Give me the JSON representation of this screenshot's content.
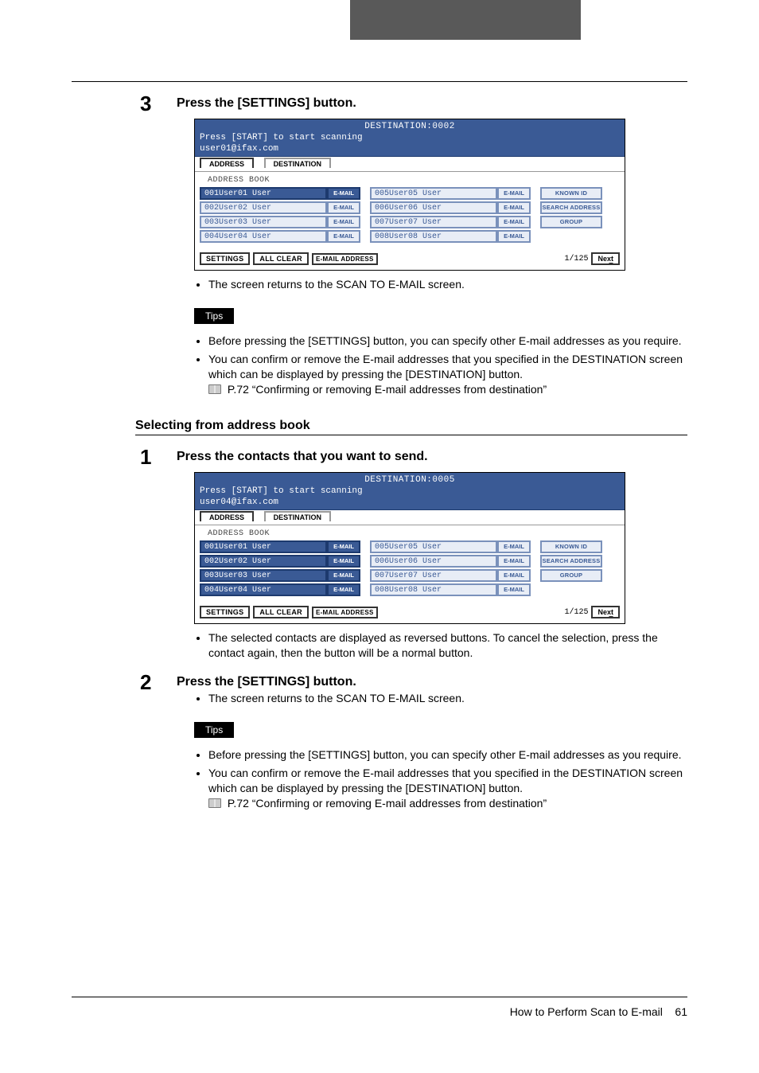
{
  "page": {
    "footer_title": "How to Perform Scan to E-mail",
    "footer_page": "61"
  },
  "step3": {
    "num": "3",
    "title": "Press the [SETTINGS] button.",
    "after_panel_bullet": "The screen returns to the SCAN TO E-MAIL screen.",
    "tips_label": "Tips",
    "tip1": "Before pressing the [SETTINGS] button, you can specify other E-mail addresses as you require.",
    "tip2": "You can confirm or remove the E-mail addresses that you specified in the DESTINATION screen which can be displayed by pressing the [DESTINATION] button.",
    "tip2_ref": " P.72 “Confirming or removing E-mail addresses from destination”"
  },
  "section2": {
    "title": "Selecting from address book"
  },
  "s2step1": {
    "num": "1",
    "title": "Press the contacts that you want to send.",
    "after_panel_bullet": "The selected contacts are displayed as reversed buttons.  To cancel the selection, press the contact again, then the button will be a normal button."
  },
  "s2step2": {
    "num": "2",
    "title": "Press the [SETTINGS] button.",
    "bullet": "The screen returns to the SCAN TO E-MAIL screen.",
    "tips_label": "Tips",
    "tip1": "Before pressing the [SETTINGS] button, you can specify other E-mail addresses as you require.",
    "tip2": "You can confirm or remove the E-mail addresses that you specified in the DESTINATION screen which can be displayed by pressing the [DESTINATION] button.",
    "tip2_ref": " P.72 “Confirming or removing E-mail addresses from destination”"
  },
  "panel_common": {
    "start_hint": "Press [START] to start scanning",
    "tab_address": "ADDRESS",
    "tab_destination": "DESTINATION",
    "ab_label": "ADDRESS BOOK",
    "email": "E-MAIL",
    "known_id": "KNOWN ID",
    "search_address": "SEARCH ADDRESS",
    "group": "GROUP",
    "settings": "SETTINGS",
    "all_clear": "ALL CLEAR",
    "email_address": "E-MAIL ADDRESS",
    "pager": "1/125",
    "next": "Next"
  },
  "panelA": {
    "dest_title": "DESTINATION:0002",
    "user_line": "user01@ifax.com",
    "rows": [
      {
        "l": "001User01 User",
        "r": "005User05 User",
        "lsel": true
      },
      {
        "l": "002User02 User",
        "r": "006User06 User"
      },
      {
        "l": "003User03 User",
        "r": "007User07 User"
      },
      {
        "l": "004User04 User",
        "r": "008User08 User"
      }
    ]
  },
  "panelB": {
    "dest_title": "DESTINATION:0005",
    "user_line": "user04@ifax.com",
    "rows": [
      {
        "l": "001User01 User",
        "r": "005User05 User",
        "lsel": true
      },
      {
        "l": "002User02 User",
        "r": "006User06 User",
        "lsel": true
      },
      {
        "l": "003User03 User",
        "r": "007User07 User",
        "lsel": true
      },
      {
        "l": "004User04 User",
        "r": "008User08 User",
        "lsel": true
      }
    ]
  }
}
